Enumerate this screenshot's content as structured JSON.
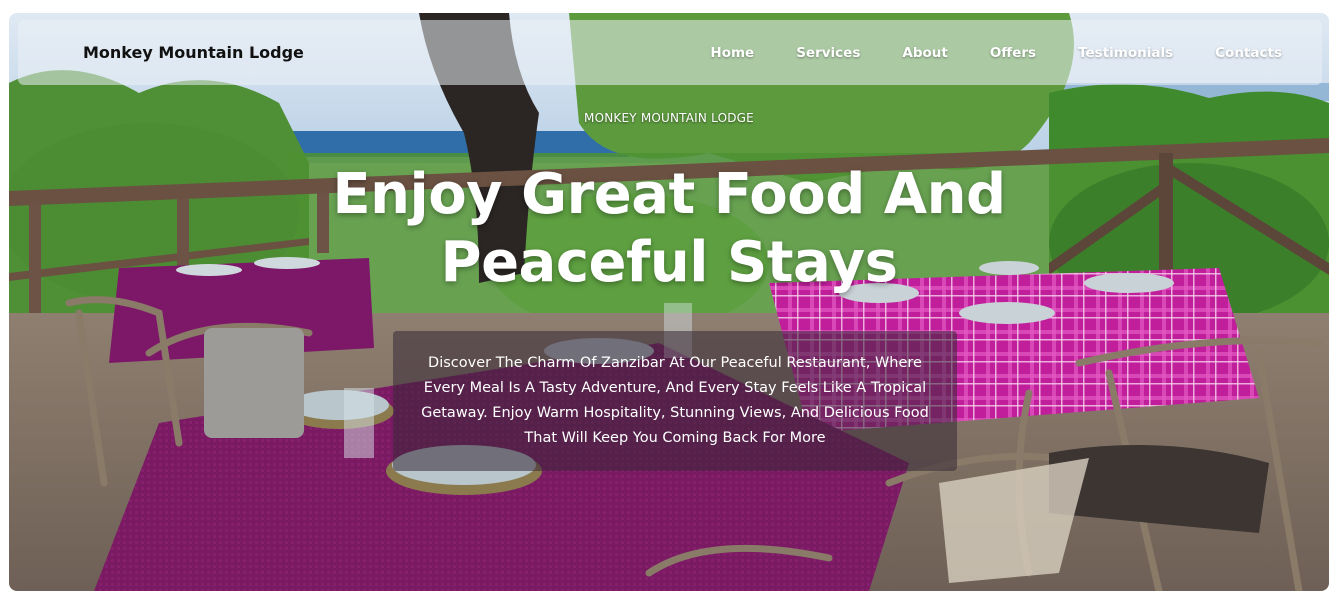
{
  "header": {
    "brand": "Monkey Mountain Lodge",
    "nav": [
      "Home",
      "Services",
      "About",
      "Offers",
      "Testimonials",
      "Contacts"
    ]
  },
  "hero": {
    "kicker": "MONKEY MOUNTAIN LODGE",
    "headline_line1": "Enjoy Great Food And",
    "headline_line2": "Peaceful Stays",
    "description": "Discover The Charm Of Zanzibar At Our Peaceful Restaurant, Where Every Meal Is A Tasty Adventure, And Every Stay Feels Like A Tropical Getaway. Enjoy Warm Hospitality, Stunning Views, And Delicious Food That Will Keep You Coming Back For More"
  },
  "colors": {
    "brand_text": "#111111",
    "nav_text": "#ffffff",
    "tablecloth_purple": "#7a1a62",
    "tablecloth_pink": "#c01e9a",
    "foliage": "#3f8a2c",
    "sea": "#2f6ea8"
  }
}
